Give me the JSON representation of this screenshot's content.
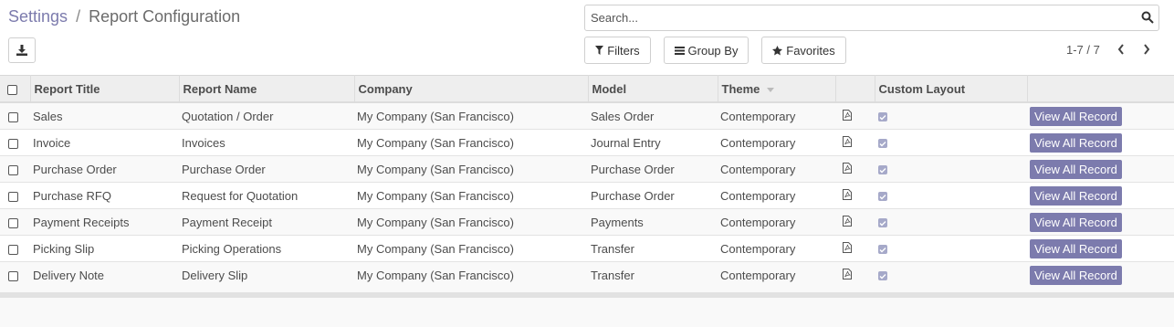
{
  "breadcrumb": {
    "parent": "Settings",
    "separator": "/",
    "current": "Report Configuration"
  },
  "search": {
    "placeholder": "Search..."
  },
  "filters": {
    "filters_label": "Filters",
    "group_by_label": "Group By",
    "favorites_label": "Favorites"
  },
  "pager": {
    "text": "1-7 / 7"
  },
  "table": {
    "headers": {
      "report_title": "Report Title",
      "report_name": "Report Name",
      "company": "Company",
      "model": "Model",
      "theme": "Theme",
      "custom_layout": "Custom Layout"
    },
    "rows": [
      {
        "title": "Sales",
        "name": "Quotation / Order",
        "company": "My Company (San Francisco)",
        "model": "Sales Order",
        "theme": "Contemporary",
        "action": "View All Record"
      },
      {
        "title": "Invoice",
        "name": "Invoices",
        "company": "My Company (San Francisco)",
        "model": "Journal Entry",
        "theme": "Contemporary",
        "action": "View All Record"
      },
      {
        "title": "Purchase Order",
        "name": "Purchase Order",
        "company": "My Company (San Francisco)",
        "model": "Purchase Order",
        "theme": "Contemporary",
        "action": "View All Record"
      },
      {
        "title": "Purchase RFQ",
        "name": "Request for Quotation",
        "company": "My Company (San Francisco)",
        "model": "Purchase Order",
        "theme": "Contemporary",
        "action": "View All Record"
      },
      {
        "title": "Payment Receipts",
        "name": "Payment Receipt",
        "company": "My Company (San Francisco)",
        "model": "Payments",
        "theme": "Contemporary",
        "action": "View All Record"
      },
      {
        "title": "Picking Slip",
        "name": "Picking Operations",
        "company": "My Company (San Francisco)",
        "model": "Transfer",
        "theme": "Contemporary",
        "action": "View All Record"
      },
      {
        "title": "Delivery Note",
        "name": "Delivery Slip",
        "company": "My Company (San Francisco)",
        "model": "Transfer",
        "theme": "Contemporary",
        "action": "View All Record"
      }
    ]
  },
  "colors": {
    "accent": "#7c7bad",
    "checkbox_checked": "#a6a9c9"
  },
  "icons": {
    "download": "download-icon",
    "search": "search-icon",
    "filter": "filter-icon",
    "group_by": "list-icon",
    "favorites": "star-icon",
    "pager_prev": "chevron-left-icon",
    "pager_next": "chevron-right-icon",
    "sort": "caret-down-icon",
    "pdf": "pdf-file-icon"
  }
}
